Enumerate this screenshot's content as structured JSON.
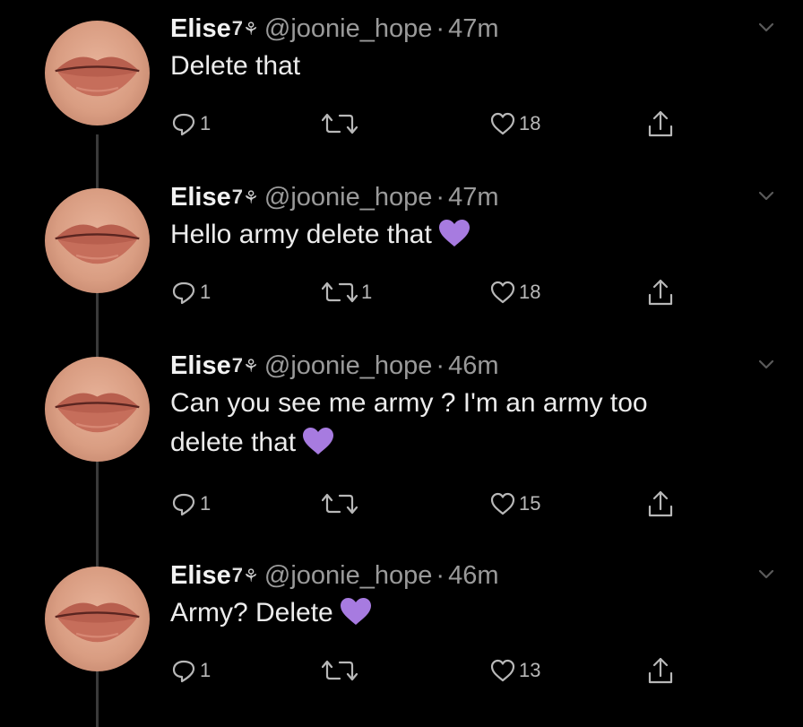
{
  "tweets": [
    {
      "name": "Elise",
      "badge": "7",
      "handle": "@joonie_hope",
      "time": "47m",
      "text": "Delete that",
      "heart_emoji": false,
      "reply_count": "1",
      "retweet_count": "",
      "like_count": "18"
    },
    {
      "name": "Elise",
      "badge": "7",
      "handle": "@joonie_hope",
      "time": "47m",
      "text": "Hello army delete that",
      "heart_emoji": true,
      "reply_count": "1",
      "retweet_count": "1",
      "like_count": "18"
    },
    {
      "name": "Elise",
      "badge": "7",
      "handle": "@joonie_hope",
      "time": "46m",
      "text": "Can you see me army ? I'm an army too delete that",
      "heart_emoji": true,
      "reply_count": "1",
      "retweet_count": "",
      "like_count": "15"
    },
    {
      "name": "Elise",
      "badge": "7",
      "handle": "@joonie_hope",
      "time": "46m",
      "text": "Army? Delete",
      "heart_emoji": true,
      "reply_count": "1",
      "retweet_count": "",
      "like_count": "13"
    }
  ],
  "colors": {
    "background": "#000000",
    "thread_line": "#3a3a3a",
    "icon": "#b8b8b8",
    "heart_emoji": "#a77be0"
  }
}
